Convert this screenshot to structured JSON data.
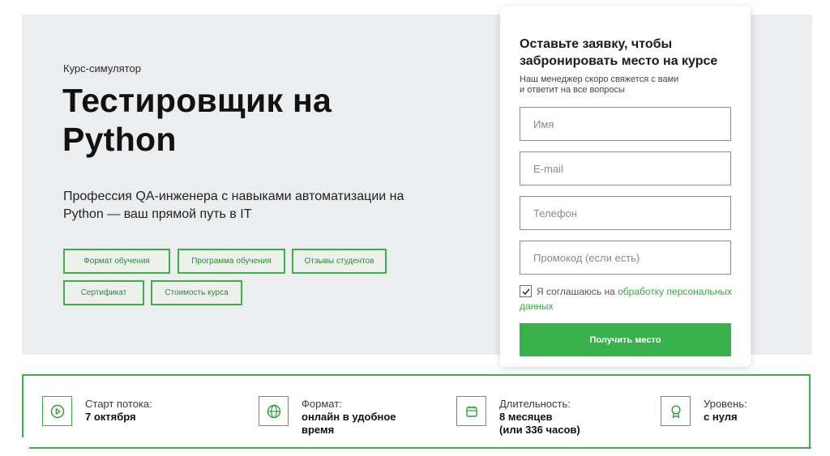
{
  "hero": {
    "kicker": "Курс-симулятор",
    "title_line1": "Тестировщик на",
    "title_line2": "Python",
    "subtitle": "Профессия QA-инженера с навыками автоматизации на Python — ваш прямой путь в IT",
    "chips": [
      "Формат обучения",
      "Программа обучения",
      "Отзывы студентов",
      "Сертификат",
      "Стоимость курса"
    ]
  },
  "form": {
    "title": "Оставьте заявку, чтобы забронировать место на курсе",
    "subtitle_line1": "Наш менеджер скоро свяжется с вами",
    "subtitle_line2": "и ответит на все вопросы",
    "fields": {
      "name_placeholder": "Имя",
      "email_placeholder": "E-mail",
      "phone_placeholder": "Телефон",
      "promo_placeholder": "Промокод (если есть)"
    },
    "consent_text": "Я соглашаюсь на ",
    "consent_link": "обработку персональных данных",
    "consent_checked": true,
    "submit_label": "Получить место"
  },
  "info": [
    {
      "icon": "play-circle-icon",
      "label": "Старт потока:",
      "value_line1": "7 октября",
      "value_line2": ""
    },
    {
      "icon": "globe-icon",
      "label": "Формат:",
      "value_line1": "онлайн в удобное",
      "value_line2": "время"
    },
    {
      "icon": "calendar-icon",
      "label": "Длительность:",
      "value_line1": "8 месяцев",
      "value_line2": "(или 336 часов)"
    },
    {
      "icon": "award-icon",
      "label": "Уровень:",
      "value_line1": "с нуля",
      "value_line2": ""
    }
  ],
  "colors": {
    "accent": "#39b14a",
    "hero_bg": "#ecedef"
  }
}
